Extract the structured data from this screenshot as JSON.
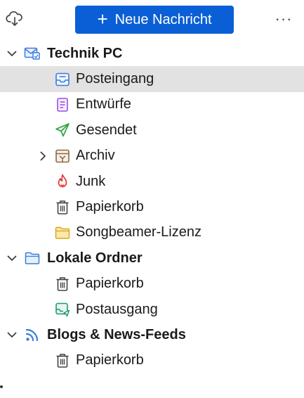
{
  "toolbar": {
    "new_message_label": "Neue Nachricht",
    "new_message_plus": "+",
    "more_label": "···",
    "accent_color": "#0b5fd6"
  },
  "folders": {
    "technik_pc": {
      "label": "Technik PC",
      "icon": "mail-account-icon",
      "expanded": true,
      "children": {
        "posteingang": {
          "label": "Posteingang",
          "icon": "inbox-icon",
          "selected": true
        },
        "entwuerfe": {
          "label": "Entwürfe",
          "icon": "drafts-icon"
        },
        "gesendet": {
          "label": "Gesendet",
          "icon": "sent-icon"
        },
        "archiv": {
          "label": "Archiv",
          "icon": "archive-icon",
          "collapsed": true
        },
        "junk": {
          "label": "Junk",
          "icon": "junk-icon"
        },
        "papierkorb": {
          "label": "Papierkorb",
          "icon": "trash-icon"
        },
        "songbeamer": {
          "label": "Songbeamer-Lizenz",
          "icon": "folder-icon"
        }
      }
    },
    "lokale_ordner": {
      "label": "Lokale Ordner",
      "icon": "local-folders-icon",
      "expanded": true,
      "children": {
        "papierkorb": {
          "label": "Papierkorb",
          "icon": "trash-icon"
        },
        "postausgang": {
          "label": "Postausgang",
          "icon": "outbox-icon"
        }
      }
    },
    "blogs_news": {
      "label": "Blogs & News-Feeds",
      "icon": "rss-icon",
      "expanded": true,
      "children": {
        "papierkorb": {
          "label": "Papierkorb",
          "icon": "trash-icon"
        }
      }
    }
  }
}
